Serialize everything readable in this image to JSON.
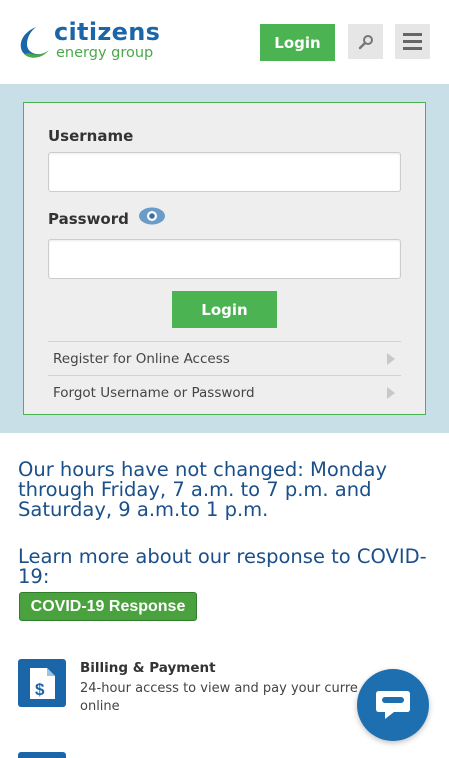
{
  "brand": {
    "name_line1": "citizens",
    "name_line2": "energy group",
    "primary_color": "#1b66a8",
    "accent_color": "#4cb352"
  },
  "header": {
    "login_label": "Login",
    "search_icon": "search-icon",
    "menu_icon": "hamburger-menu-icon"
  },
  "login_form": {
    "username_label": "Username",
    "username_value": "",
    "password_label": "Password",
    "password_value": "",
    "password_toggle_icon": "eye-icon",
    "submit_label": "Login",
    "links": [
      {
        "label": "Register for Online Access"
      },
      {
        "label": "Forgot Username or Password"
      }
    ]
  },
  "content": {
    "hours_text": "Our hours have not changed: Monday through Friday, 7 a.m. to 7 p.m. and Saturday, 9 a.m.to 1 p.m.",
    "covid_text": "Learn more about our response to COVID-19:",
    "covid_button_label": "COVID-19 Response",
    "billing": {
      "title": "Billing & Payment",
      "description": "24-hour access to view and pay your curre",
      "description_line2": "online",
      "icon": "bill-dollar-icon"
    }
  },
  "chat": {
    "icon": "chat-bubble-icon"
  }
}
